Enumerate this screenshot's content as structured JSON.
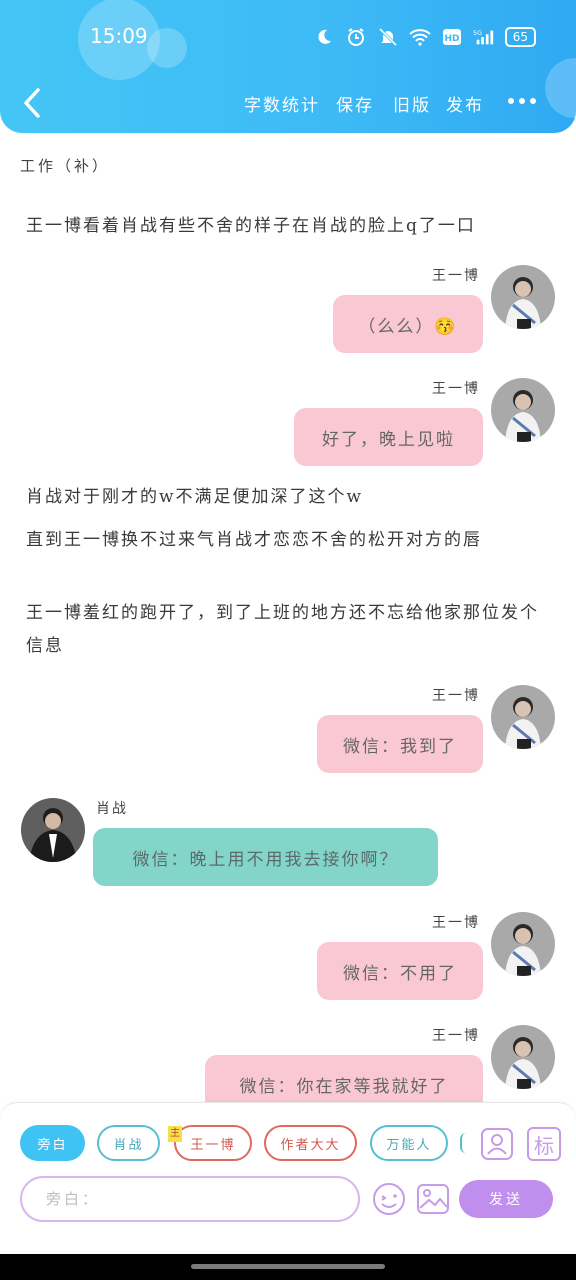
{
  "status_bar": {
    "time": "15:09",
    "battery": "65"
  },
  "header": {
    "actions": [
      "字数统计",
      "保存",
      "旧版",
      "发布"
    ]
  },
  "chapter_title": "工作（补）",
  "messages": [
    {
      "type": "narration",
      "text": "王一博看着肖战有些不舍的样子在肖战的脸上q了一口"
    },
    {
      "type": "right",
      "name": "王一博",
      "text": "（么么）😚"
    },
    {
      "type": "right",
      "name": "王一博",
      "text": "好了，晚上见啦"
    },
    {
      "type": "narration",
      "text": "肖战对于刚才的w不满足便加深了这个w"
    },
    {
      "type": "narration",
      "text": "直到王一博换不过来气肖战才恋恋不舍的松开对方的唇"
    },
    {
      "type": "narration",
      "text": "王一博羞红的跑开了，到了上班的地方还不忘给他家那位发个信息"
    },
    {
      "type": "right",
      "name": "王一博",
      "text": "微信：我到了"
    },
    {
      "type": "left",
      "name": "肖战",
      "text": "微信：晚上用不用我去接你啊？"
    },
    {
      "type": "right",
      "name": "王一博",
      "text": "微信：不用了"
    },
    {
      "type": "right",
      "name": "王一博",
      "text": "微信：你在家等我就好了"
    }
  ],
  "roles": [
    {
      "label": "旁白",
      "active": true
    },
    {
      "label": "肖战"
    },
    {
      "label": "王一博",
      "badge": "主"
    },
    {
      "label": "作者大大"
    },
    {
      "label": "万能人"
    }
  ],
  "input": {
    "placeholder": "旁白："
  },
  "send_label": "发送",
  "icons": {
    "mark_label": "标"
  },
  "colors": {
    "header": "#3db9f6",
    "pink_bubble": "#f9c8d2",
    "teal_bubble": "#82d5c8",
    "accent_purple": "#c08fee"
  }
}
